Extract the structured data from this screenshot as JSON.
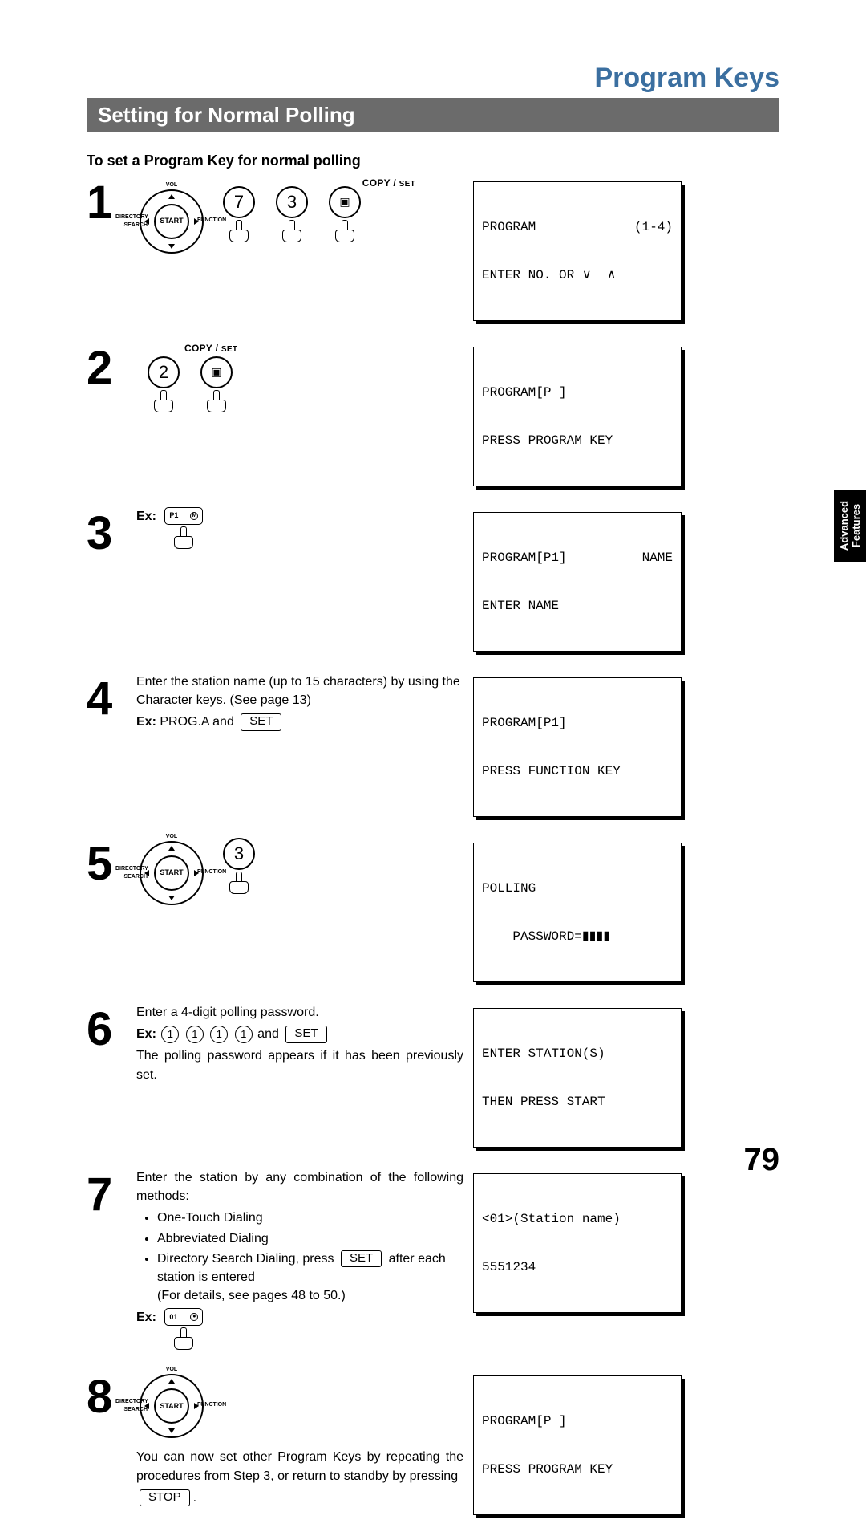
{
  "header": {
    "title": "Program Keys"
  },
  "section": {
    "bar": "Setting for Normal Polling",
    "subhead": "To set a Program Key for normal polling"
  },
  "copy_set": {
    "a": "COPY / ",
    "b": "SET"
  },
  "nav": {
    "start": "START",
    "vol": "VOL",
    "dir": "DIRECTORY\nSEARCH",
    "func": "FUNCTION"
  },
  "steps": {
    "s1": {
      "num": "1",
      "k1": "7",
      "k2": "3",
      "lcd_a1": "PROGRAM",
      "lcd_a1r": "(1-4)",
      "lcd_a2": "ENTER NO. OR ∨  ∧"
    },
    "s2": {
      "num": "2",
      "k1": "2",
      "lcd_a1": "PROGRAM[P ]",
      "lcd_a2": "PRESS PROGRAM KEY"
    },
    "s3": {
      "num": "3",
      "ex": "Ex:",
      "flat_lbl": "P1",
      "flat_ico": "M",
      "lcd_a1": "PROGRAM[P1]",
      "lcd_a1r": "NAME",
      "lcd_a2": "ENTER NAME"
    },
    "s4": {
      "num": "4",
      "text1": "Enter the station name (up to 15 characters) by using the Character keys.  (See page 13)",
      "ex": "Ex:",
      "ex_text": " PROG.A and ",
      "set": "SET",
      "lcd_a1": "PROGRAM[P1]",
      "lcd_a2": "PRESS FUNCTION KEY"
    },
    "s5": {
      "num": "5",
      "k1": "3",
      "lcd_a1": "POLLING",
      "lcd_a2": "    PASSWORD=",
      "mask": "▮▮▮▮"
    },
    "s6": {
      "num": "6",
      "text1": "Enter a 4-digit polling password.",
      "ex": "Ex:",
      "d": "1",
      "and": " and ",
      "set": "SET",
      "text2": "The polling password appears if it has been previously set.",
      "lcd_a1": "ENTER STATION(S)",
      "lcd_a2": "THEN PRESS START"
    },
    "s7": {
      "num": "7",
      "text1": "Enter the station by any combination of the following methods:",
      "b1": "One-Touch Dialing",
      "b2": "Abbreviated Dialing",
      "b3a": "Directory Search Dialing, press ",
      "b3_set": "SET",
      "b3b": " after each station is entered",
      "b3c": "(For details, see pages 48 to 50.)",
      "ex": "Ex:",
      "flat_lbl": "01",
      "flat_ico": "●",
      "lcd_a1": "<01>(Station name)",
      "lcd_a2": "5551234"
    },
    "s8": {
      "num": "8",
      "text1": "You can now set other Program Keys by repeating the procedures from Step 3, or return to standby by pressing",
      "stop": "STOP",
      "period": ".",
      "lcd_a1": "PROGRAM[P ]",
      "lcd_a2": "PRESS PROGRAM KEY"
    }
  },
  "side_tab": "Advanced\nFeatures",
  "page_number": "79"
}
